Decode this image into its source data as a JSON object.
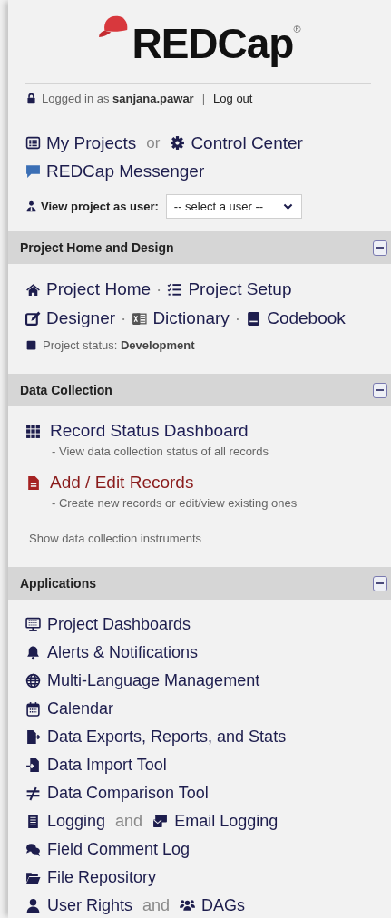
{
  "logo": {
    "name": "REDCap",
    "mark": "®"
  },
  "account": {
    "user": "Logged in as **sanjana.pawar**",
    "separator": "|",
    "logout": "Log out"
  },
  "nav": [
    {
      "links": [
        {
          "label": "My Projects"
        },
        {
          "prefix": "or",
          "label": "Control Center"
        }
      ]
    },
    {
      "links": [
        {
          "label": "REDCap Messenger"
        }
      ]
    }
  ],
  "view_as": {
    "label": "View project as user:",
    "value": "-- select a user --"
  },
  "sections": [
    {
      "kind": "design",
      "title": "Project Home and Design",
      "expanded": true,
      "rows": [
        {
          "links": [
            {
              "label": "Project Home"
            },
            {
              "prefix": "·",
              "label": "Project Setup"
            }
          ]
        },
        {
          "links": [
            {
              "label": "Designer"
            },
            {
              "prefix": "·",
              "label": "Dictionary"
            },
            {
              "prefix": "·",
              "label": "Codebook"
            }
          ]
        }
      ],
      "status": "Project status:  **Development**"
    },
    {
      "kind": "records",
      "title": "Data Collection",
      "expanded": true,
      "links": [
        {
          "label": "Record Status Dashboard",
          "description": "- View data collection status of all records",
          "color": "#1e1e55"
        },
        {
          "label": "Add / Edit Records",
          "description": "- Create new records or edit/view existing ones",
          "color": "#8a1c1c"
        }
      ],
      "footer": "Show data collection instruments"
    },
    {
      "kind": "apps",
      "title": "Applications",
      "expanded": true,
      "rows": [
        {
          "links": [
            {
              "label": "Project Dashboards"
            }
          ]
        },
        {
          "links": [
            {
              "label": "Alerts & Notifications"
            }
          ]
        },
        {
          "links": [
            {
              "label": "Multi-Language Management"
            }
          ]
        },
        {
          "links": [
            {
              "label": "Calendar"
            }
          ]
        },
        {
          "links": [
            {
              "label": "Data Exports, Reports, and Stats"
            }
          ]
        },
        {
          "links": [
            {
              "label": "Data Import Tool"
            }
          ]
        },
        {
          "links": [
            {
              "label": "Data Comparison Tool"
            }
          ]
        },
        {
          "links": [
            {
              "label": "Logging"
            },
            {
              "prefix": "and",
              "label": "Email Logging"
            }
          ]
        },
        {
          "links": [
            {
              "label": "Field Comment Log"
            }
          ]
        },
        {
          "links": [
            {
              "label": "File Repository"
            }
          ]
        },
        {
          "links": [
            {
              "label": "User Rights"
            },
            {
              "prefix": "and",
              "label": "DAGs"
            }
          ]
        }
      ]
    }
  ]
}
